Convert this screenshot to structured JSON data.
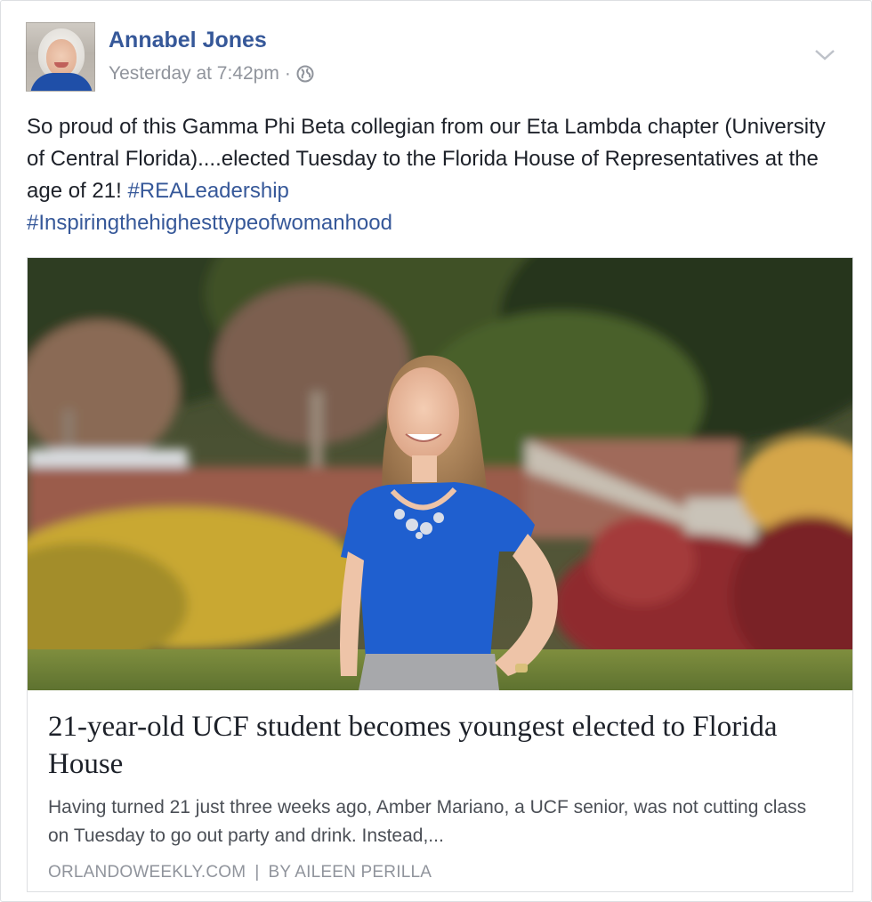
{
  "post": {
    "author": "Annabel Jones",
    "timestamp": "Yesterday at 7:42pm",
    "separator": "·",
    "privacy_icon": "globe-icon",
    "menu_icon": "chevron-down-icon",
    "text_plain": "So proud of this Gamma Phi Beta collegian from our Eta Lambda chapter (University of Central Florida)....elected Tuesday to the Florida House of Representatives at the age of 21! ",
    "hashtags": [
      "#REALeadership",
      "#Inspiringthehighesttypeofwomanhood"
    ],
    "link_color": "#365899"
  },
  "link_card": {
    "image_alt": "Photo of a smiling young woman in a blue top standing outdoors",
    "title": "21-year-old UCF student becomes youngest elected to Florida House",
    "description": "Having turned 21 just three weeks ago, Amber Mariano, a UCF senior, was not cutting class on Tuesday to go out party and drink. Instead,...",
    "domain": "ORLANDOWEEKLY.COM",
    "divider": "|",
    "byline": "BY AILEEN PERILLA"
  }
}
